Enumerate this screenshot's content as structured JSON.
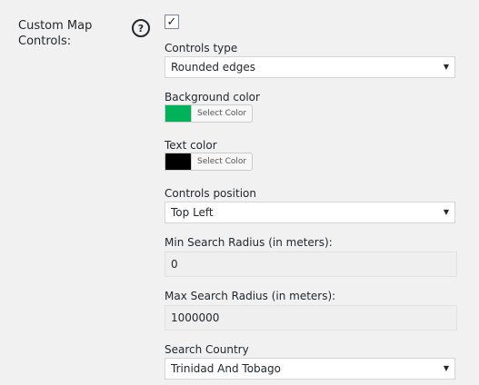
{
  "field": {
    "label": "Custom Map Controls:",
    "help_glyph": "?",
    "checkbox_checked": true,
    "checkbox_glyph": "✓"
  },
  "controls_type": {
    "label": "Controls type",
    "value": "Rounded edges",
    "arrow": "▼"
  },
  "background_color": {
    "label": "Background color",
    "color": "#00b35a",
    "button_label": "Select Color"
  },
  "text_color": {
    "label": "Text color",
    "color": "#000000",
    "button_label": "Select Color"
  },
  "controls_position": {
    "label": "Controls position",
    "value": "Top Left",
    "arrow": "▼"
  },
  "min_radius": {
    "label": "Min Search Radius (in meters):",
    "value": "0"
  },
  "max_radius": {
    "label": "Max Search Radius (in meters):",
    "value": "1000000"
  },
  "search_country": {
    "label": "Search Country",
    "value": "Trinidad And Tobago",
    "arrow": "▼"
  },
  "icons": {
    "help": "help-icon",
    "checkbox": "checkbox-icon",
    "dropdown": "dropdown-arrow-icon"
  }
}
